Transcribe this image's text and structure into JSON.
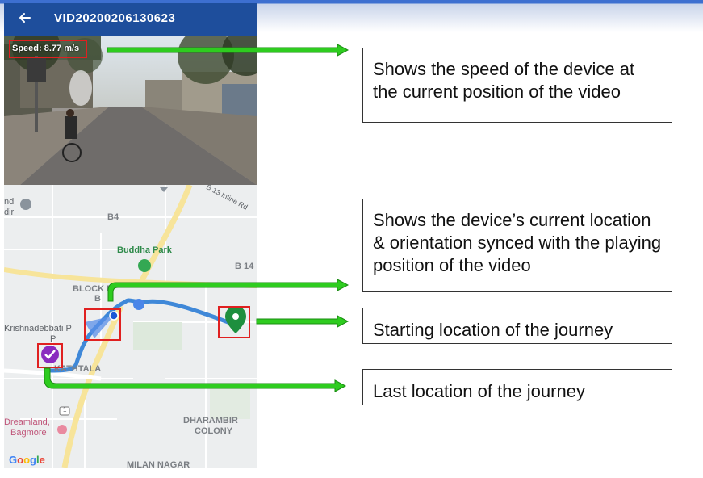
{
  "app_bar": {
    "title": "VID20200206130623",
    "back_icon": "arrow-left-icon",
    "color": "#1e4e9c"
  },
  "video": {
    "speed_overlay": "Speed: 8.77 m/s"
  },
  "map": {
    "labels": {
      "road_top": "B 13 Inline Rd",
      "b4": "B4",
      "park": "Buddha Park",
      "b14": "B 14",
      "block": "BLOCK B",
      "b": "B",
      "krishna": "Krishnadebbati P",
      "krishna2": "P",
      "nd": "nd",
      "dir": "dir",
      "kathtala": "KATHTALA",
      "dreamland": "Dreamland,",
      "bagmore": "Bagmore",
      "dharambir": "DHARAMBIR",
      "colony": "COLONY",
      "milan": "MILAN NAGAR",
      "route_no": "1"
    },
    "google_letters": [
      "G",
      "o",
      "o",
      "g",
      "l",
      "e"
    ],
    "route_color": "#3f88d8",
    "start_pin_color": "#1e8f3e",
    "end_marker_color": "#8a2bbf"
  },
  "callouts": {
    "speed": "Shows the speed of the device at the current position of the video",
    "current_location": "Shows the device’s current location & orientation synced with the playing position of the video",
    "start": "Starting location of the journey",
    "last": "Last location of the journey"
  },
  "colors": {
    "arrow": "#2ecc1f",
    "highlight": "#e02020"
  }
}
